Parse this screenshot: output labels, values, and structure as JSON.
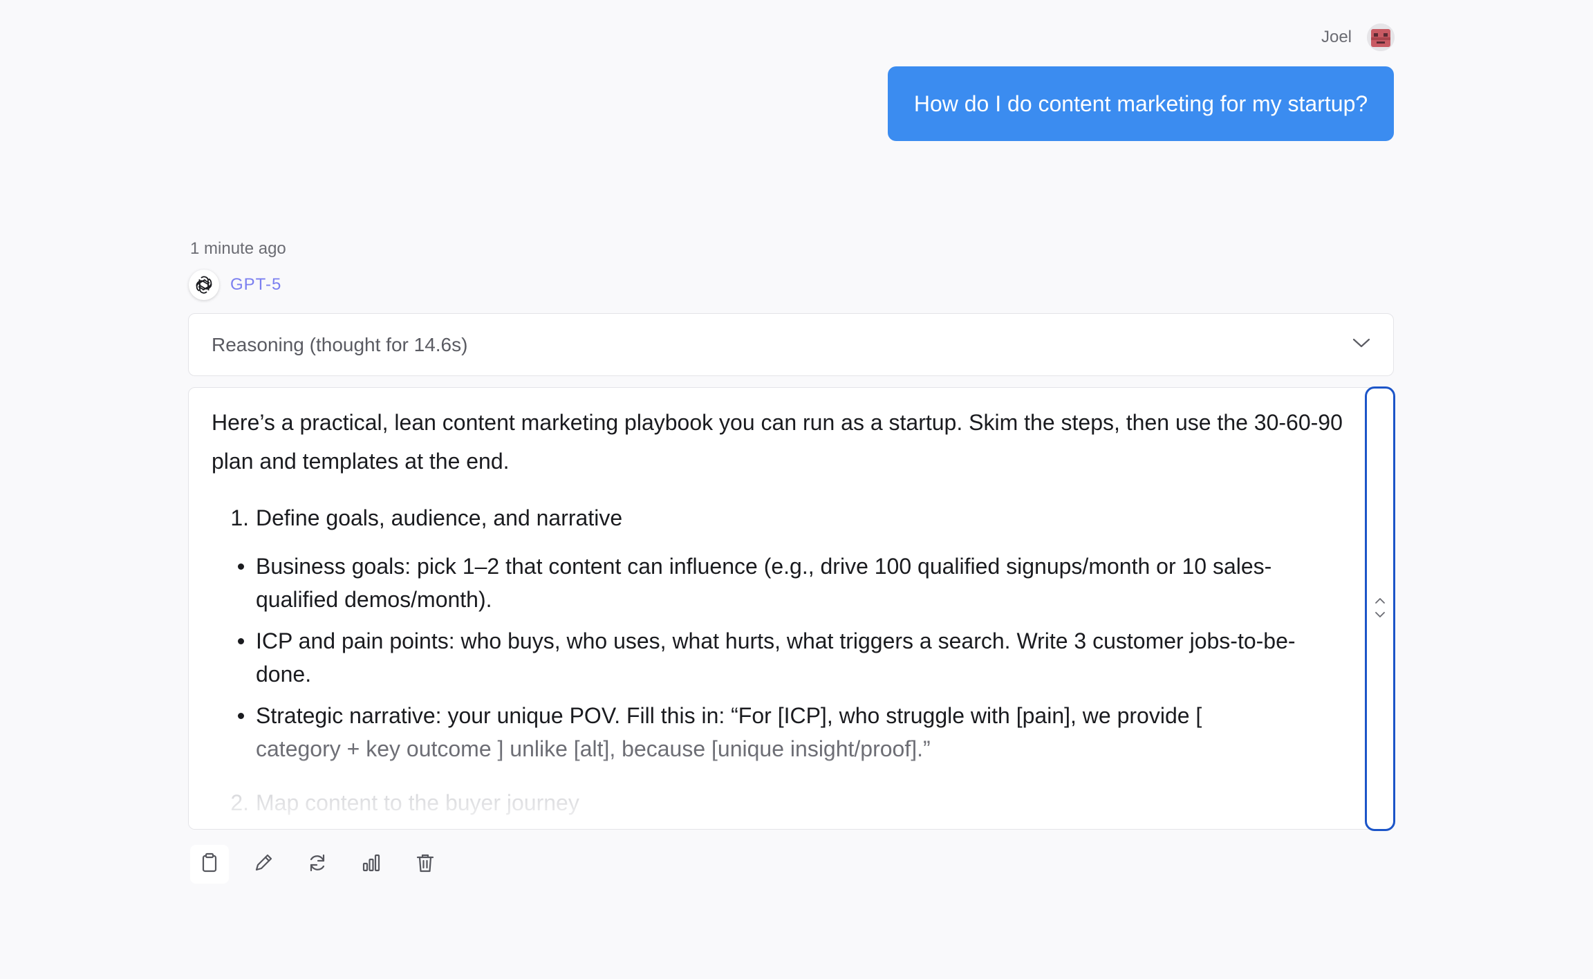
{
  "user": {
    "name": "Joel",
    "avatar_icon": "pixel-avatar-icon",
    "message": "How do I do content marketing for my startup?"
  },
  "assistant": {
    "timestamp": "1 minute ago",
    "model_icon": "openai-logo-icon",
    "model_name": "GPT-5",
    "reasoning_label": "Reasoning (thought for 14.6s)",
    "intro": "Here’s a practical, lean content marketing playbook you can run as a startup. Skim the steps, then use the 30-60-90 plan and templates at the end.",
    "step1_number": "1.",
    "step1_title": "Define goals, audience, and narrative",
    "bullets": [
      "Business goals: pick 1–2 that content can influence (e.g., drive 100 qualified signups/month or 10 sales-qualified demos/month).",
      "ICP and pain points: who buys, who uses, what hurts, what triggers a search. Write 3 customer jobs-to-be-done.",
      "Strategic narrative: your unique POV. Fill this in: “For [ICP], who struggle with [pain], we provide [",
      "category + key outcome ] unlike [alt], because [unique insight/proof].”"
    ],
    "step2_number": "2.",
    "step2_title": "Map content to the buyer journey"
  },
  "actions": {
    "copy_icon": "clipboard-icon",
    "edit_icon": "pencil-icon",
    "regenerate_icon": "refresh-icon",
    "stats_icon": "bar-chart-icon",
    "delete_icon": "trash-icon"
  },
  "colors": {
    "user_bubble": "#3b8cf0",
    "model_name": "#7b7ff0",
    "scroll_handle": "#1c55c8",
    "background": "#f9f9fb"
  }
}
